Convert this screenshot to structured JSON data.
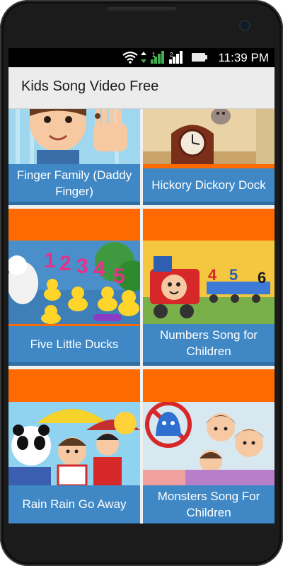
{
  "status_bar": {
    "time": "11:39 PM",
    "icons": [
      "wifi-icon",
      "data-arrows-icon",
      "signal-icon",
      "signal-r-icon",
      "battery-icon"
    ]
  },
  "app_bar": {
    "title": "Kids Song Video Free"
  },
  "videos": [
    {
      "title": "Finger Family (Daddy Finger)",
      "thumbnail": "finger-family-thumbnail"
    },
    {
      "title": "Hickory Dickory Dock",
      "thumbnail": "hickory-dickory-thumbnail"
    },
    {
      "title": "Five Little Ducks",
      "thumbnail": "five-little-ducks-thumbnail"
    },
    {
      "title": "Numbers Song for Children",
      "thumbnail": "numbers-song-thumbnail"
    },
    {
      "title": "Rain Rain Go Away",
      "thumbnail": "rain-rain-thumbnail"
    },
    {
      "title": "Monsters Song For Children",
      "thumbnail": "monsters-song-thumbnail"
    }
  ],
  "colors": {
    "tile_bg": "#ff6a00",
    "caption_bg": "#3f88c5",
    "app_bar_bg": "#ececec",
    "status_bar_bg": "#000000"
  }
}
